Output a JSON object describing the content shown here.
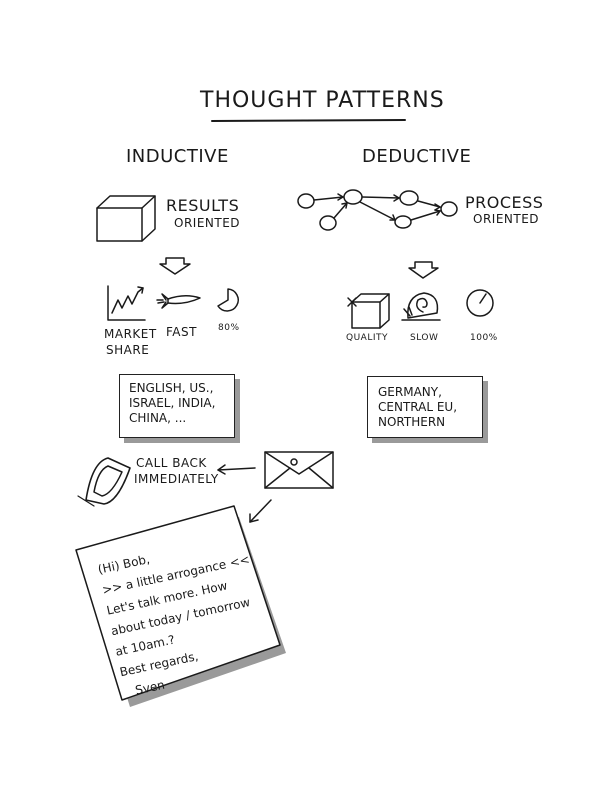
{
  "title": "THOUGHT PATTERNS",
  "inductive": {
    "heading": "INDUCTIVE",
    "orientation_line1": "RESULTS",
    "orientation_line2": "ORIENTED",
    "traits": [
      {
        "label_line1": "MARKET",
        "label_line2": "SHARE",
        "icon": "chart-icon"
      },
      {
        "label_line1": "FAST",
        "label_line2": "",
        "icon": "rocket-icon"
      },
      {
        "label_line1": "80%",
        "label_line2": "",
        "icon": "pie-icon"
      }
    ],
    "regions": "ENGLISH, US.,\nISRAEL, INDIA,\nCHINA, ..."
  },
  "deductive": {
    "heading": "DEDUCTIVE",
    "orientation_line1": "PROCESS",
    "orientation_line2": "ORIENTED",
    "traits": [
      {
        "label": "QUALITY",
        "icon": "cube-icon"
      },
      {
        "label": "SLOW",
        "icon": "snail-icon"
      },
      {
        "label": "100%",
        "icon": "full-circle-icon"
      }
    ],
    "regions": "GERMANY,\nCENTRAL EU,\nNORTHERN"
  },
  "action": {
    "label_line1": "CALL BACK",
    "label_line2": "IMMEDIATELY",
    "icons": [
      "phone-icon",
      "envelope-icon",
      "arrow-icon"
    ]
  },
  "note": {
    "text": "(Hi) Bob,\n>> a little arrogance <<\nLet's talk more. How\nabout today / tomorrow\nat 10am.?\nBest regards,\n   Sven"
  }
}
